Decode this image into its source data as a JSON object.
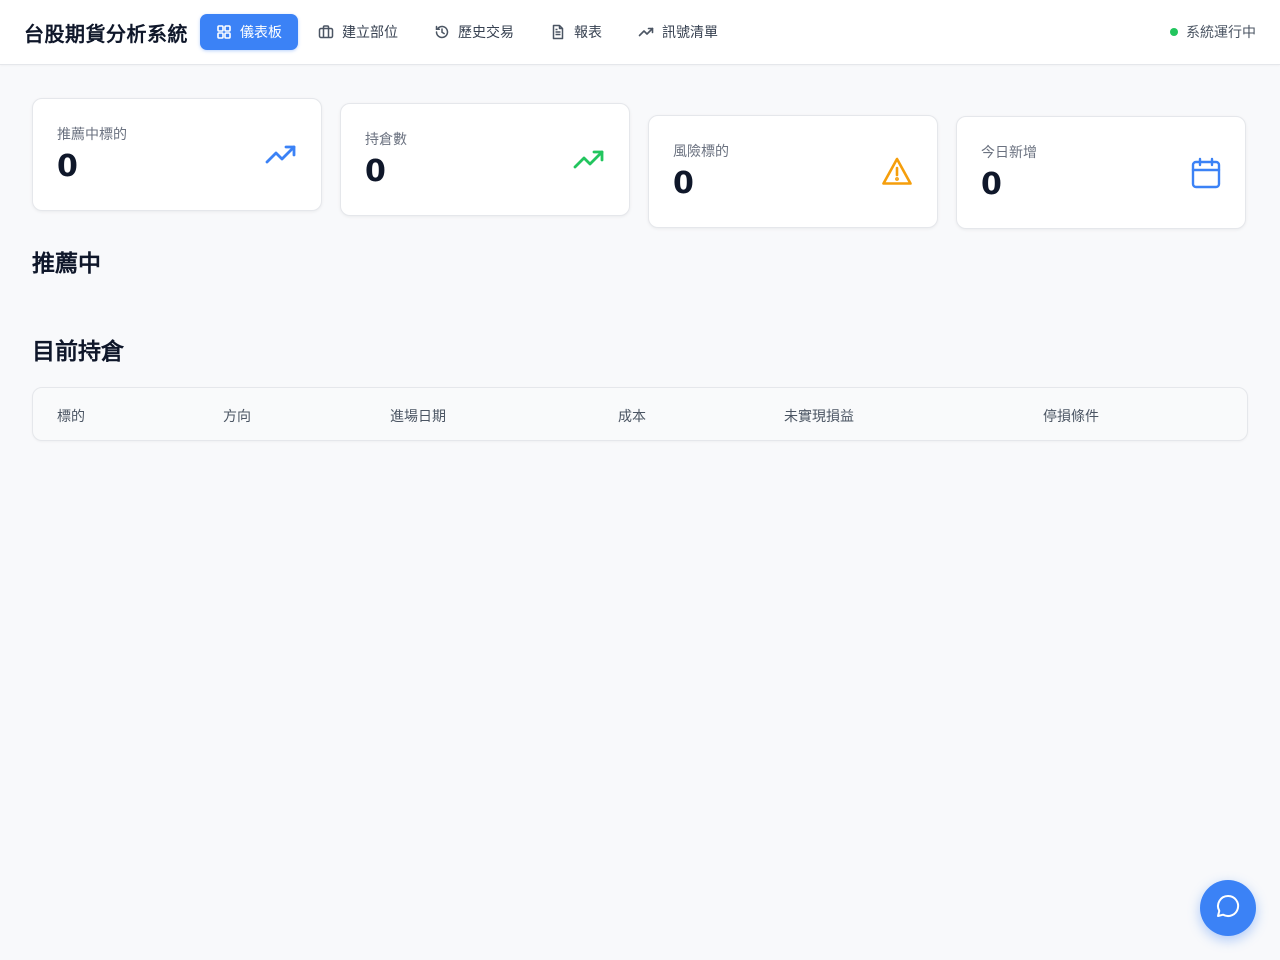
{
  "app": {
    "title": "台股期貨分析系統",
    "status_text": "系統運行中",
    "status_color": "#22c55e",
    "accent_color": "#3b82f6"
  },
  "nav": {
    "items": [
      {
        "label": "儀表板",
        "icon": "grid-icon",
        "active": true
      },
      {
        "label": "建立部位",
        "icon": "briefcase-icon",
        "active": false
      },
      {
        "label": "歷史交易",
        "icon": "history-icon",
        "active": false
      },
      {
        "label": "報表",
        "icon": "document-icon",
        "active": false
      },
      {
        "label": "訊號清單",
        "icon": "trending-up-icon",
        "active": false
      }
    ]
  },
  "stats": [
    {
      "label": "推薦中標的",
      "value": "0",
      "icon": "trending-up-icon",
      "icon_color": "#3b82f6"
    },
    {
      "label": "持倉數",
      "value": "0",
      "icon": "trending-up-icon",
      "icon_color": "#22c55e"
    },
    {
      "label": "風險標的",
      "value": "0",
      "icon": "warning-icon",
      "icon_color": "#f59e0b"
    },
    {
      "label": "今日新增",
      "value": "0",
      "icon": "calendar-icon",
      "icon_color": "#3b82f6"
    }
  ],
  "sections": {
    "recommended_title": "推薦中",
    "positions_title": "目前持倉"
  },
  "positions_table": {
    "columns": [
      "標的",
      "方向",
      "進場日期",
      "成本",
      "未實現損益",
      "停損條件"
    ],
    "rows": []
  },
  "chat_button": {
    "icon": "chat-icon"
  }
}
